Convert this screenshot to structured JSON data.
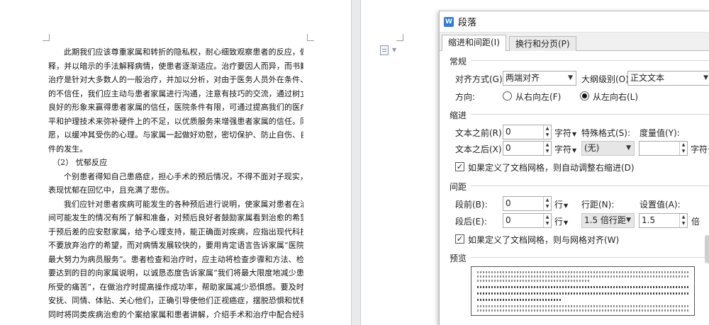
{
  "document": {
    "lines": [
      "此期我们应该尊重家属和转折的隐私权，耐心细致观察患者的反应，做好解",
      "释，并以暗示的手法解释病情，使患者逐渐适应。治疗要因人而异，而书籍上的",
      "治疗是针对大多数人的一般治疗，并加以分析，对由于医务人员外在条件、引起",
      "的不信任，我们应主动与患者家属进行沟通，注意有技巧的交流，通过树立自己",
      "良好的形象来赢得患者家属的信任，医院条件有限，可通过提高我们的医疗诊断水",
      "平和护理技术来弥补硬件上的不足，以优质服务来增强患者家属的信任。同时顺其意",
      "愿，以缓冲其受伤的心理。与家属一起做好劝慰，密切保护、防止自伤、自杀事",
      "件的发生。",
      "（2） 忧郁反应",
      "个别患者得知自己患癌症，担心手术的预后情况，不得不面对子现实，往往",
      "表现忧郁在回忆中，且充满了悲伤。",
      "我们应针对患者疾病可能发生的各种预后进行说明，使家属对患者在治疗期",
      "间可能发生的情况有所了解和准备，对预后良好者鼓励家属看到治愈的希望，对",
      "于预后差的应安慰家属，给予心理支持，能正确面对疾病，应指出现代科技进步，",
      "不要放弃治疗的希望，而对病情发展较快的，要用肯定语言告诉家属“医院会尽",
      "最大努力为病员服务”。患者检查和治疗时，应主动将检查步骤和方法、检查治疗",
      "要达到的目的向家属说明，以诚恳态度告诉家属“我们将最大限度地减少患者",
      "所受的痛苦”，在做治疗时提高操作成功率，帮助家属减少恐惧感。要及时进行",
      "安抚、同情、体贴、关心他们，正确引导使他们正视癌症，摆脱恐惧和忧郁。",
      "同时将同类疾病治愈的个案给家属和患者讲解，介绍手术和治疗中配合经验，并"
    ]
  },
  "dialog": {
    "title": "段落",
    "tabs": [
      "缩进和间距(I)",
      "换行和分页(P)"
    ],
    "general": {
      "section": "常规",
      "align_label": "对齐方式(G):",
      "align_value": "两端对齐",
      "outline_label": "大纲级别(O):",
      "outline_value": "正文文本",
      "direction_label": "方向:",
      "rtl_label": "从右向左(F)",
      "ltr_label": "从左向右(L)"
    },
    "indent": {
      "section": "缩进",
      "before_label": "文本之前(R):",
      "before_value": "0",
      "before_unit": "字符",
      "after_label": "文本之后(X):",
      "after_value": "0",
      "after_unit": "字符",
      "special_label": "特殊格式(S):",
      "special_value": "(无)",
      "measure_label": "度量值(Y):",
      "measure_value": "",
      "measure_unit": "字符",
      "grid_check_label": "如果定义了文档网格，则自动调整右缩进(D)"
    },
    "spacing": {
      "section": "间距",
      "before_label": "段前(B):",
      "before_value": "0",
      "before_unit": "行",
      "after_label": "段后(E):",
      "after_value": "0",
      "after_unit": "行",
      "line_label": "行距(N):",
      "line_value": "1.5 倍行距",
      "set_label": "设置值(A):",
      "set_value": "1.5",
      "set_unit": "倍",
      "grid_check_label": "如果定义了文档网格，则与网格对齐(W)"
    },
    "preview": {
      "section": "预览"
    }
  }
}
